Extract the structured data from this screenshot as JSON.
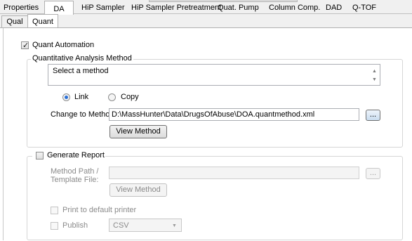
{
  "tabs_top": [
    "Properties",
    "DA",
    "HiP Sampler",
    "HiP Sampler Pretreatment",
    "Quat. Pump",
    "Column Comp.",
    "DAD",
    "Q-TOF"
  ],
  "tabs_sub": [
    "Qual",
    "Quant"
  ],
  "quant_automation": {
    "label": "Quant Automation",
    "checked": true
  },
  "method_group": {
    "title": "Quantitative Analysis Method",
    "select_text": "Select a method",
    "link_label": "Link",
    "copy_label": "Copy",
    "change_label": "Change to Method:",
    "change_path": "D:\\MassHunter\\Data\\DrugsOfAbuse\\DOA.quantmethod.xml",
    "browse_label": "...",
    "view_method_label": "View Method"
  },
  "report_group": {
    "title": "Generate Report",
    "method_path_label_1": "Method Path /",
    "method_path_label_2": "Template File:",
    "path_value": "",
    "browse_label": "...",
    "view_method_label": "View Method",
    "print_label": "Print to default printer",
    "publish_label": "Publish",
    "publish_format": "CSV"
  }
}
